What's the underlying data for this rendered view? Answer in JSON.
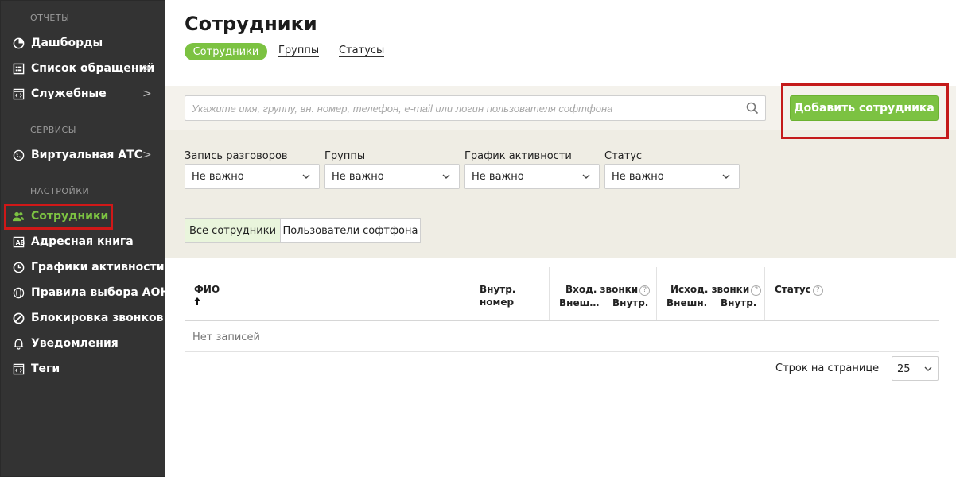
{
  "sidebar": {
    "sections": [
      {
        "title": "ОТЧЕТЫ"
      },
      {
        "title": "СЕРВИСЫ"
      },
      {
        "title": "НАСТРОЙКИ"
      }
    ],
    "items": [
      {
        "label": "Дашборды",
        "icon": "pie-chart-icon",
        "chevron": ""
      },
      {
        "label": "Список обращений",
        "icon": "list-icon",
        "chevron": ">"
      },
      {
        "label": "Служебные",
        "icon": "code-doc-icon",
        "chevron": ">"
      },
      {
        "label": "Виртуальная АТС",
        "icon": "pbx-icon",
        "chevron": ">"
      },
      {
        "label": "Сотрудники",
        "icon": "users-icon",
        "chevron": ""
      },
      {
        "label": "Адресная книга",
        "icon": "address-book-icon",
        "chevron": ""
      },
      {
        "label": "Графики активности",
        "icon": "clock-icon",
        "chevron": ""
      },
      {
        "label": "Правила выбора АОН",
        "icon": "globe-phone-icon",
        "chevron": ""
      },
      {
        "label": "Блокировка звонков",
        "icon": "block-icon",
        "chevron": ""
      },
      {
        "label": "Уведомления",
        "icon": "bell-icon",
        "chevron": ""
      },
      {
        "label": "Теги",
        "icon": "tag-doc-icon",
        "chevron": ""
      }
    ],
    "active_item": "Сотрудники",
    "accent_color": "#7cc242"
  },
  "main": {
    "title": "Сотрудники",
    "tabs": [
      {
        "label": "Сотрудники",
        "active": true
      },
      {
        "label": "Группы",
        "active": false
      },
      {
        "label": "Статусы",
        "active": false
      }
    ],
    "search": {
      "placeholder": "Укажите имя, группу, вн. номер, телефон, e-mail или логин пользователя софтфона",
      "value": ""
    },
    "add_button": "Добавить сотрудника",
    "filters": [
      {
        "label": "Запись разговоров",
        "value": "Не важно"
      },
      {
        "label": "Группы",
        "value": "Не важно"
      },
      {
        "label": "График активности",
        "value": "Не важно"
      },
      {
        "label": "Статус",
        "value": "Не важно"
      }
    ],
    "segment": [
      {
        "label": "Все сотрудники",
        "active": true
      },
      {
        "label": "Пользователи софтфона",
        "active": false
      }
    ],
    "table": {
      "col_name": "ФИО",
      "col_ext_1": "Внутр.",
      "col_ext_2": "номер",
      "col_in": "Вход. звонки",
      "col_in_ext": "Внеш…",
      "col_in_int": "Внутр.",
      "col_out": "Исход. звонки",
      "col_out_ext": "Внешн.",
      "col_out_int": "Внутр.",
      "col_status": "Статус",
      "help_glyph": "?",
      "empty_text": "Нет записей"
    },
    "pagination": {
      "rows_label": "Строк на странице",
      "rows_value": "25"
    }
  },
  "colors": {
    "sidebar_bg": "#333333",
    "green": "#7cc242",
    "highlight_red": "#c41a1a",
    "band_bg": "#efede4"
  }
}
